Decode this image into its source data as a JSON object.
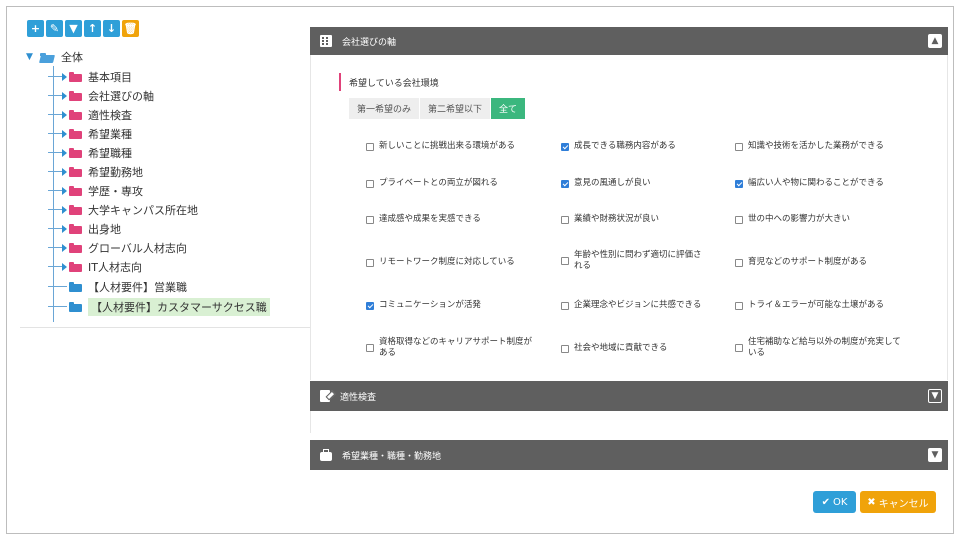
{
  "toolbar": {
    "buttons": [
      {
        "name": "add",
        "glyph": "+"
      },
      {
        "name": "edit",
        "glyph": "✎"
      },
      {
        "name": "filter",
        "glyph": "▼"
      },
      {
        "name": "move-up",
        "glyph": "↑"
      },
      {
        "name": "move-down",
        "glyph": "↓"
      },
      {
        "name": "delete",
        "glyph": "🗑"
      }
    ]
  },
  "tree": {
    "root": "全体",
    "nodes": [
      {
        "label": "基本項目",
        "type": "folder-pink",
        "expandable": true
      },
      {
        "label": "会社選びの軸",
        "type": "folder-pink",
        "expandable": true
      },
      {
        "label": "適性検査",
        "type": "folder-pink",
        "expandable": true
      },
      {
        "label": "希望業種",
        "type": "folder-pink",
        "expandable": true
      },
      {
        "label": "希望職種",
        "type": "folder-pink",
        "expandable": true
      },
      {
        "label": "希望勤務地",
        "type": "folder-pink",
        "expandable": true
      },
      {
        "label": "学歴・専攻",
        "type": "folder-pink",
        "expandable": true
      },
      {
        "label": "大学キャンパス所在地",
        "type": "folder-pink",
        "expandable": true
      },
      {
        "label": "出身地",
        "type": "folder-pink",
        "expandable": true
      },
      {
        "label": "グローバル人材志向",
        "type": "folder-pink",
        "expandable": true
      },
      {
        "label": "IT人材志向",
        "type": "folder-pink",
        "expandable": true
      },
      {
        "label": "【人材要件】営業職",
        "type": "folder-blue",
        "expandable": false
      },
      {
        "label": "【人材要件】カスタマーサクセス職",
        "type": "folder-blue",
        "expandable": false,
        "selected": true
      }
    ]
  },
  "panels": {
    "company_axis": {
      "title": "会社選びの軸",
      "toggle": "▲"
    },
    "aptitude": {
      "title": "適性検査",
      "toggle": "▼"
    },
    "preference": {
      "title": "希望業種・職種・勤務地",
      "toggle": "▼"
    }
  },
  "company_axis": {
    "subheading": "希望している会社環境",
    "tabs": [
      {
        "label": "第一希望のみ",
        "active": false
      },
      {
        "label": "第二希望以下",
        "active": false
      },
      {
        "label": "全て",
        "active": true
      }
    ],
    "options": [
      {
        "label": "新しいことに挑戦出来る環境がある",
        "checked": false
      },
      {
        "label": "成長できる職務内容がある",
        "checked": true
      },
      {
        "label": "知識や技術を活かした業務ができる",
        "checked": false
      },
      {
        "label": "プライベートとの両立が図れる",
        "checked": false
      },
      {
        "label": "意見の風通しが良い",
        "checked": true
      },
      {
        "label": "幅広い人や物に関わることができる",
        "checked": true
      },
      {
        "label": "達成感や成果を実感できる",
        "checked": false
      },
      {
        "label": "業績や財務状況が良い",
        "checked": false
      },
      {
        "label": "世の中への影響力が大きい",
        "checked": false
      },
      {
        "label": "リモートワーク制度に対応している",
        "checked": false
      },
      {
        "label": "年齢や性別に問わず適切に評価される",
        "checked": false
      },
      {
        "label": "育児などのサポート制度がある",
        "checked": false
      },
      {
        "label": "コミュニケーションが活発",
        "checked": true
      },
      {
        "label": "企業理念やビジョンに共感できる",
        "checked": false
      },
      {
        "label": "トライ＆エラーが可能な土壌がある",
        "checked": false
      },
      {
        "label": "資格取得などのキャリアサポート制度がある",
        "checked": false
      },
      {
        "label": "社会や地域に貢献できる",
        "checked": false
      },
      {
        "label": "住宅補助など給与以外の制度が充実している",
        "checked": false
      }
    ]
  },
  "footer": {
    "ok_label": "OK",
    "cancel_label": "キャンセル",
    "ok_glyph": "✔",
    "cancel_glyph": "✖"
  },
  "colors": {
    "accent_blue": "#2f9fd8",
    "accent_orange": "#f0a30a",
    "active_tab": "#3bb77e",
    "folder_pink": "#e0427a",
    "panel_header": "#5f5f5f"
  }
}
